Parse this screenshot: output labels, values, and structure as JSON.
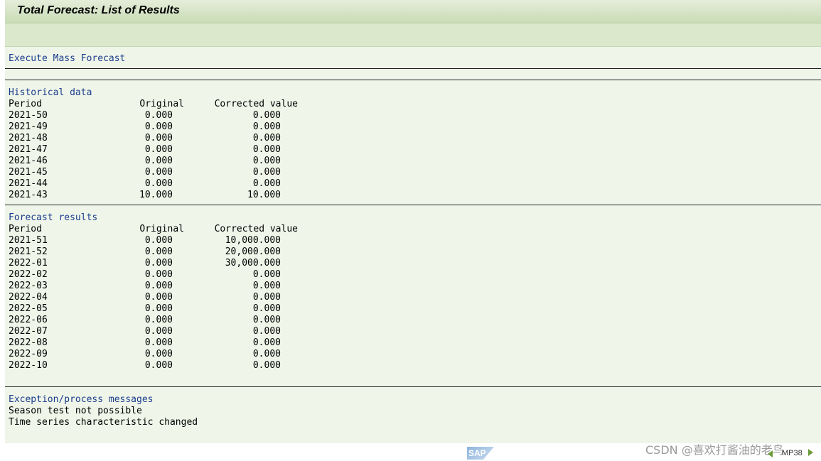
{
  "window": {
    "title": "Total Forecast: List of Results"
  },
  "actions": {
    "execute_mass_forecast": "Execute Mass Forecast"
  },
  "historical": {
    "heading": "Historical data",
    "columns": [
      "Period",
      "Original",
      "Corrected value"
    ],
    "rows": [
      {
        "period": "2021-50",
        "original": "0.000",
        "corrected": "0.000"
      },
      {
        "period": "2021-49",
        "original": "0.000",
        "corrected": "0.000"
      },
      {
        "period": "2021-48",
        "original": "0.000",
        "corrected": "0.000"
      },
      {
        "period": "2021-47",
        "original": "0.000",
        "corrected": "0.000"
      },
      {
        "period": "2021-46",
        "original": "0.000",
        "corrected": "0.000"
      },
      {
        "period": "2021-45",
        "original": "0.000",
        "corrected": "0.000"
      },
      {
        "period": "2021-44",
        "original": "0.000",
        "corrected": "0.000"
      },
      {
        "period": "2021-43",
        "original": "10.000",
        "corrected": "10.000"
      }
    ]
  },
  "forecast": {
    "heading": "Forecast results",
    "columns": [
      "Period",
      "Original",
      "Corrected value"
    ],
    "rows": [
      {
        "period": "2021-51",
        "original": "0.000",
        "corrected": "10,000.000"
      },
      {
        "period": "2021-52",
        "original": "0.000",
        "corrected": "20,000.000"
      },
      {
        "period": "2022-01",
        "original": "0.000",
        "corrected": "30,000.000"
      },
      {
        "period": "2022-02",
        "original": "0.000",
        "corrected": "0.000"
      },
      {
        "period": "2022-03",
        "original": "0.000",
        "corrected": "0.000"
      },
      {
        "period": "2022-04",
        "original": "0.000",
        "corrected": "0.000"
      },
      {
        "period": "2022-05",
        "original": "0.000",
        "corrected": "0.000"
      },
      {
        "period": "2022-06",
        "original": "0.000",
        "corrected": "0.000"
      },
      {
        "period": "2022-07",
        "original": "0.000",
        "corrected": "0.000"
      },
      {
        "period": "2022-08",
        "original": "0.000",
        "corrected": "0.000"
      },
      {
        "period": "2022-09",
        "original": "0.000",
        "corrected": "0.000"
      },
      {
        "period": "2022-10",
        "original": "0.000",
        "corrected": "0.000"
      }
    ]
  },
  "messages": {
    "heading": "Exception/process messages",
    "lines": [
      "Season test not possible",
      "Time series characteristic changed"
    ]
  },
  "statusbar": {
    "logo_text": "SAP",
    "transaction": "MP38",
    "watermark": "CSDN @喜欢打酱油的老鸟"
  },
  "colors": {
    "heading": "#1a3c8c",
    "content_bg": "#eff5e9",
    "titlebar_bg": "#c9dcb6",
    "toolbar_bg": "#dce8cc"
  }
}
